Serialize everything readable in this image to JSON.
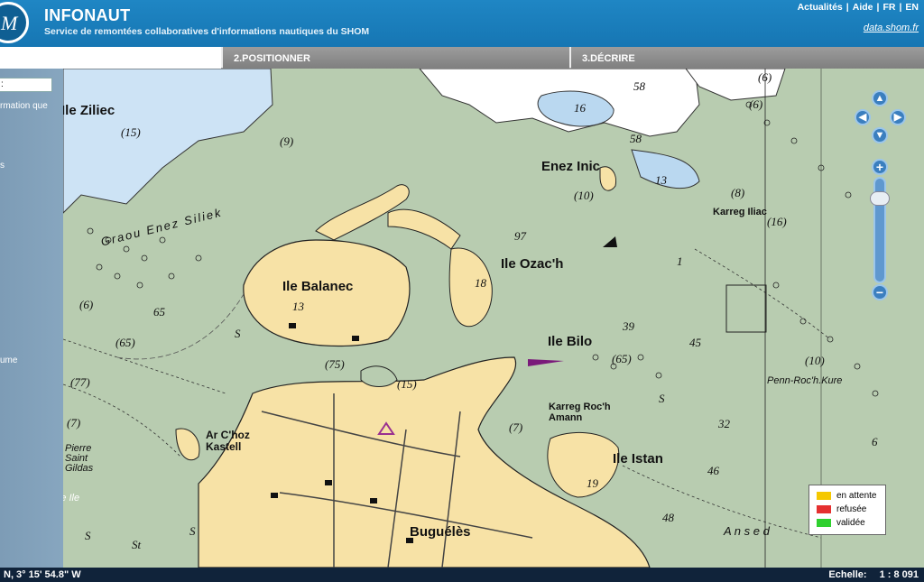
{
  "header": {
    "title": "INFONAUT",
    "subtitle": "Service de remontées collaboratives d'informations nautiques du SHOM",
    "links": [
      "Actualités",
      "Aide",
      "FR",
      "EN"
    ],
    "data_link": "data.shom.fr"
  },
  "steps": [
    "",
    "2.POSITIONNER",
    "3.DÉCRIRE"
  ],
  "left_panel": {
    "field_value": ":",
    "texts": [
      "rmation que",
      "s",
      "ume"
    ]
  },
  "map": {
    "labels": {
      "ile_ziliec": "Ile Ziliec",
      "enez_inic": "Enez Inic",
      "ile_balanec": "Ile Balanec",
      "ile_ozach": "Ile Ozac'h",
      "ile_bilo": "Ile Bilo",
      "ile_istan": "Ile Istan",
      "bugueles": "Buguélès",
      "ar_choz_kastell": "Ar C'hoz\nKastell",
      "karreg_iliac": "Karreg Iliac",
      "karreg_roch_amann": "Karreg Roc'h\nAmann",
      "penn_roch_kure": "Penn-Roc'h.Kure",
      "graou_enez_siliek": "Graou Enez Siliek",
      "pierre_saint_gildas": "Pierre\nSaint\nGildas",
      "la_petite_ile": "La Petite Ile",
      "anse": "A n s e  d"
    },
    "depths": [
      "(15)",
      "(9)",
      "16",
      "58",
      "58",
      "13",
      "(6)",
      "(6)",
      "(10)",
      "(8)",
      "(16)",
      "97",
      "1",
      "18",
      "13",
      "(6)",
      "65",
      "(65)",
      "(77)",
      "(7)",
      "(75)",
      "(15)",
      "39",
      "45",
      "(65)",
      "(10)",
      "(7)",
      "S",
      "S",
      "S",
      "32",
      "6",
      "46",
      "19",
      "48",
      "S",
      "St"
    ]
  },
  "zoom": {
    "up": "▲",
    "left": "◀",
    "right": "▶",
    "down": "▼",
    "plus": "+",
    "minus": "−"
  },
  "legend": [
    {
      "label": "en attente",
      "color": "#f5c800"
    },
    {
      "label": "refusée",
      "color": "#e53030"
    },
    {
      "label": "validée",
      "color": "#2fd02f"
    }
  ],
  "status": {
    "coords": "N,   3° 15' 54.8\" W",
    "scale_label": "Echelle:",
    "scale_value": "1 : 8 091"
  }
}
